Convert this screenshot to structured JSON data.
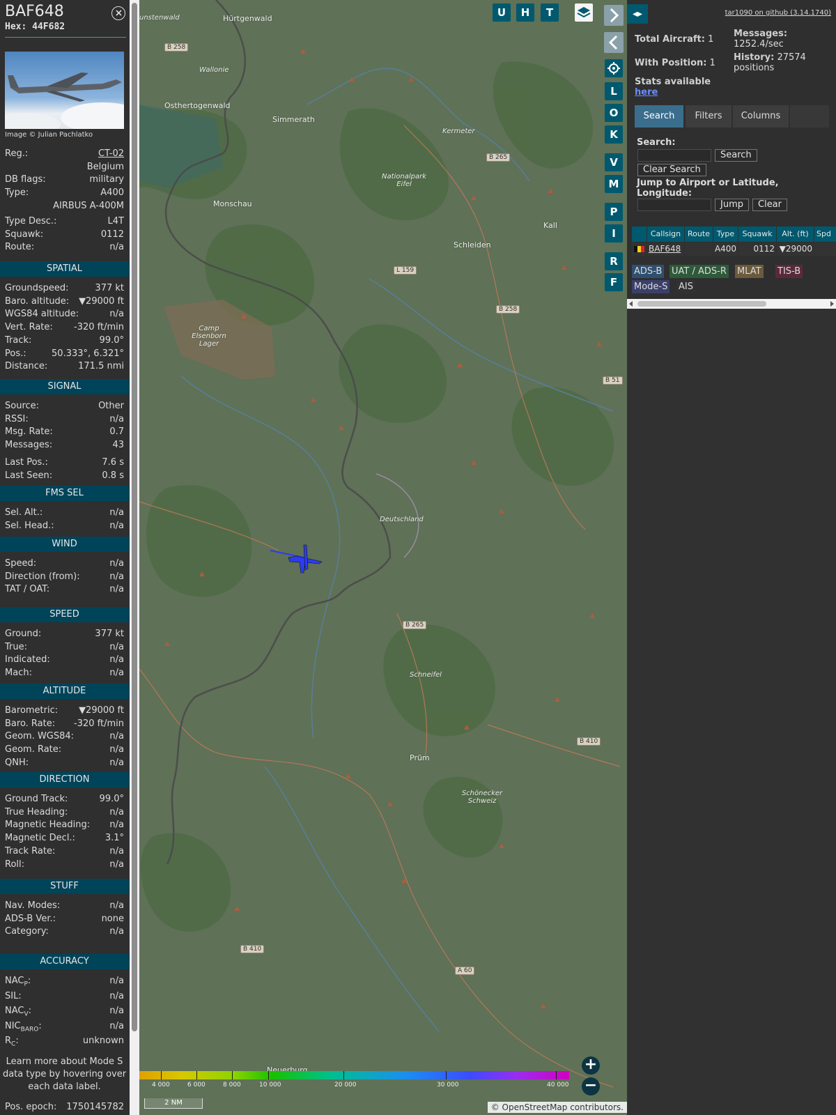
{
  "aircraft": {
    "callsign": "BAF648",
    "hex_label": "Hex:",
    "hex": "44F682",
    "photo_credit": "Image © Julian Pachlatko"
  },
  "details": [
    {
      "k": "Reg.:",
      "v": "CT-02",
      "link": true
    },
    {
      "k": "",
      "v": "Belgium"
    },
    {
      "k": "DB flags:",
      "v": "military"
    },
    {
      "k": "Type:",
      "v": "A400"
    },
    {
      "k": "",
      "v": "AIRBUS A-400M"
    },
    {
      "k": "Type Desc.:",
      "v": "L4T"
    },
    {
      "k": "Squawk:",
      "v": "0112"
    },
    {
      "k": "Route:",
      "v": "n/a"
    }
  ],
  "sections": {
    "spatial": {
      "title": "SPATIAL",
      "rows": [
        {
          "k": "Groundspeed:",
          "v": "377 kt"
        },
        {
          "k": "Baro. altitude:",
          "v": "▼29000 ft"
        },
        {
          "k": "WGS84 altitude:",
          "v": "n/a"
        },
        {
          "k": "Vert. Rate:",
          "v": "-320 ft/min"
        },
        {
          "k": "Track:",
          "v": "99.0°"
        },
        {
          "k": "Pos.:",
          "v": "50.333°, 6.321°"
        },
        {
          "k": "Distance:",
          "v": "171.5 nmi"
        }
      ]
    },
    "signal": {
      "title": "SIGNAL",
      "rows": [
        {
          "k": "Source:",
          "v": "Other"
        },
        {
          "k": "RSSI:",
          "v": "n/a"
        },
        {
          "k": "Msg. Rate:",
          "v": "0.7"
        },
        {
          "k": "Messages:",
          "v": "43"
        },
        {
          "k": "Last Pos.:",
          "v": "7.6 s"
        },
        {
          "k": "Last Seen:",
          "v": "0.8 s"
        }
      ]
    },
    "fms": {
      "title": "FMS SEL",
      "rows": [
        {
          "k": "Sel. Alt.:",
          "v": "n/a"
        },
        {
          "k": "Sel. Head.:",
          "v": "n/a"
        }
      ]
    },
    "wind": {
      "title": "WIND",
      "rows": [
        {
          "k": "Speed:",
          "v": "n/a"
        },
        {
          "k": "Direction (from):",
          "v": "n/a"
        },
        {
          "k": "TAT / OAT:",
          "v": "n/a"
        }
      ]
    },
    "speed": {
      "title": "SPEED",
      "rows": [
        {
          "k": "Ground:",
          "v": "377 kt"
        },
        {
          "k": "True:",
          "v": "n/a"
        },
        {
          "k": "Indicated:",
          "v": "n/a"
        },
        {
          "k": "Mach:",
          "v": "n/a"
        }
      ]
    },
    "altitude": {
      "title": "ALTITUDE",
      "rows": [
        {
          "k": "Barometric:",
          "v": "▼29000 ft"
        },
        {
          "k": "Baro. Rate:",
          "v": "-320 ft/min"
        },
        {
          "k": "Geom. WGS84:",
          "v": "n/a"
        },
        {
          "k": "Geom. Rate:",
          "v": "n/a"
        },
        {
          "k": "QNH:",
          "v": "n/a"
        }
      ]
    },
    "direction": {
      "title": "DIRECTION",
      "rows": [
        {
          "k": "Ground Track:",
          "v": "99.0°"
        },
        {
          "k": "True Heading:",
          "v": "n/a"
        },
        {
          "k": "Magnetic Heading:",
          "v": "n/a"
        },
        {
          "k": "Magnetic Decl.:",
          "v": "3.1°"
        },
        {
          "k": "Track Rate:",
          "v": "n/a"
        },
        {
          "k": "Roll:",
          "v": "n/a"
        }
      ]
    },
    "stuff": {
      "title": "STUFF",
      "rows": [
        {
          "k": "Nav. Modes:",
          "v": "n/a"
        },
        {
          "k": "ADS-B Ver.:",
          "v": "none"
        },
        {
          "k": "Category:",
          "v": "n/a"
        }
      ]
    },
    "accuracy": {
      "title": "ACCURACY",
      "rows": [
        {
          "k": "NAC",
          "sub": "P",
          "suffix": ":",
          "v": "n/a"
        },
        {
          "k": "SIL:",
          "v": "n/a"
        },
        {
          "k": "NAC",
          "sub": "V",
          "suffix": ":",
          "v": "n/a"
        },
        {
          "k": "NIC",
          "sub": "BARO",
          "suffix": ":",
          "v": "n/a"
        },
        {
          "k": "R",
          "sub": "C",
          "suffix": ":",
          "v": "unknown"
        }
      ]
    }
  },
  "learn_more": "Learn more about Mode S data type by hovering over each data label.",
  "pos_epoch": {
    "k": "Pos. epoch:",
    "v": "1750145782"
  },
  "map": {
    "buttons_top": [
      "U",
      "H",
      "T"
    ],
    "buttons_side": [
      "L",
      "O",
      "K",
      "V",
      "M",
      "P",
      "I",
      "R",
      "F"
    ],
    "labels": [
      {
        "t": "Hürtgenwald"
      },
      {
        "t": "Osthertogenwald"
      },
      {
        "t": "Simmerath"
      },
      {
        "t": "Monschau"
      },
      {
        "t": "Kermeter"
      },
      {
        "t": "Nationalpark Eifel"
      },
      {
        "t": "Schleiden"
      },
      {
        "t": "Kall"
      },
      {
        "t": "Camp Elsenborn Lager"
      },
      {
        "t": "Schneifel"
      },
      {
        "t": "Prüm"
      },
      {
        "t": "Schönecker Schweiz"
      },
      {
        "t": "Neuerburg"
      },
      {
        "t": "Wallonie"
      },
      {
        "t": "Deutschland"
      },
      {
        "t": "unstenwald"
      }
    ],
    "road_signs": [
      "B 258",
      "B 265",
      "L 159",
      "B 258",
      "B 51",
      "B 265",
      "B 410",
      "B 410",
      "A 60"
    ],
    "altitude_legend": [
      "4 000",
      "6 000",
      "8 000",
      "10 000",
      "20 000",
      "30 000",
      "40 000"
    ],
    "scale": "2 NM",
    "attribution": "© OpenStreetMap contributors.",
    "zoom_in": "+",
    "zoom_out": "−",
    "colors": {
      "aircraft": "#2b3cf0",
      "border": "#4a4a4a",
      "route": "#c97a5a"
    }
  },
  "right_panel": {
    "toggle": "◂▸",
    "github": "tar1090 on github (3.14.1740)",
    "total_aircraft_label": "Total Aircraft:",
    "total_aircraft": "1",
    "with_position_label": "With Position:",
    "with_position": "1",
    "messages_label": "Messages:",
    "messages": "1252.4/sec",
    "history_label": "History:",
    "history": "27574 positions",
    "stats_label": "Stats available",
    "stats_link": "here",
    "tabs": [
      "Search",
      "Filters",
      "Columns"
    ],
    "search_label": "Search:",
    "search_button": "Search",
    "clear_search_button": "Clear Search",
    "jump_label": "Jump to Airport or Latitude, Longitude:",
    "jump_button": "Jump",
    "clear_button": "Clear",
    "table_headers": [
      "Callsign",
      "Route",
      "Type",
      "Squawk",
      "Alt. (ft)",
      "Spd"
    ],
    "table_row": {
      "callsign": "BAF648",
      "route": "",
      "type": "A400",
      "squawk": "0112",
      "alt": "▼29000"
    },
    "sources": [
      {
        "label": "ADS-B",
        "color": "#2f4f6f"
      },
      {
        "label": "UAT / ADS-R",
        "color": "#2f5a3a"
      },
      {
        "label": "MLAT",
        "color": "#6b5a3c"
      },
      {
        "label": "TIS-B",
        "color": "#5a2a3a"
      },
      {
        "label": "Mode-S",
        "color": "#3a3f6a"
      },
      {
        "label": "AIS",
        "color": "#313131"
      }
    ]
  }
}
